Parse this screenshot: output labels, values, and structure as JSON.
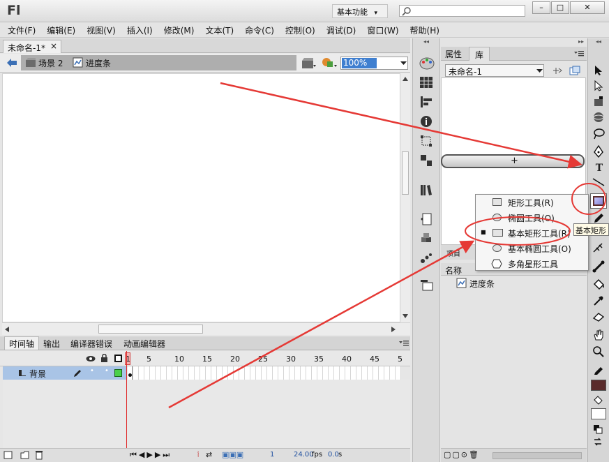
{
  "app": {
    "logo": "Fl",
    "workspace": "基本功能",
    "workspace_caret": "▾",
    "search_placeholder": "",
    "win_min": "–",
    "win_max": "□",
    "win_close": "✕"
  },
  "menu": [
    "文件(F)",
    "编辑(E)",
    "视图(V)",
    "插入(I)",
    "修改(M)",
    "文本(T)",
    "命令(C)",
    "控制(O)",
    "调试(D)",
    "窗口(W)",
    "帮助(H)"
  ],
  "document": {
    "tab_title": "未命名-1*",
    "tab_close": "×",
    "scene": "场景 2",
    "symbol": "进度条",
    "zoom": "100%"
  },
  "timeline": {
    "tabs": [
      "时间轴",
      "输出",
      "编译器错误",
      "动画编辑器"
    ],
    "layer_name": "背景",
    "frame_numbers": [
      "1",
      "5",
      "10",
      "15",
      "20",
      "25",
      "30",
      "35",
      "40",
      "45",
      "5"
    ],
    "current_frame": "1",
    "fps": "24.00",
    "fps_unit": "fps",
    "time": "0.0",
    "time_unit": "s"
  },
  "library": {
    "tabs": [
      "属性",
      "库"
    ],
    "doc_select": "未命名-1",
    "button_label": "+",
    "items_count_prefix": "项目",
    "col_name": "名称",
    "item_name": "进度条"
  },
  "tool_flyout": {
    "items": [
      {
        "label": "矩形工具(R)",
        "selected": false,
        "shape": "rect"
      },
      {
        "label": "椭圆工具(O)",
        "selected": false,
        "shape": "ellipse"
      },
      {
        "label": "基本矩形工具(R)",
        "selected": true,
        "shape": "rect"
      },
      {
        "label": "基本椭圆工具(O)",
        "selected": false,
        "shape": "ellipse"
      },
      {
        "label": "多角星形工具",
        "selected": false,
        "shape": "polygon"
      }
    ],
    "bullet": "■"
  },
  "tooltip": "基本矩形",
  "colors": {
    "stroke_color": "#5a2b2b",
    "fill_color": "#ffffff",
    "annotation_red": "#e53935",
    "layer_highlight": "#a9c4e6",
    "zoom_highlight": "#3f7fd0"
  },
  "icons": {
    "back": "back-arrow-icon",
    "scene": "scene-icon",
    "symbol": "symbol-icon",
    "edit_scene": "edit-scene-icon",
    "edit_symbol": "edit-symbol-icon"
  }
}
